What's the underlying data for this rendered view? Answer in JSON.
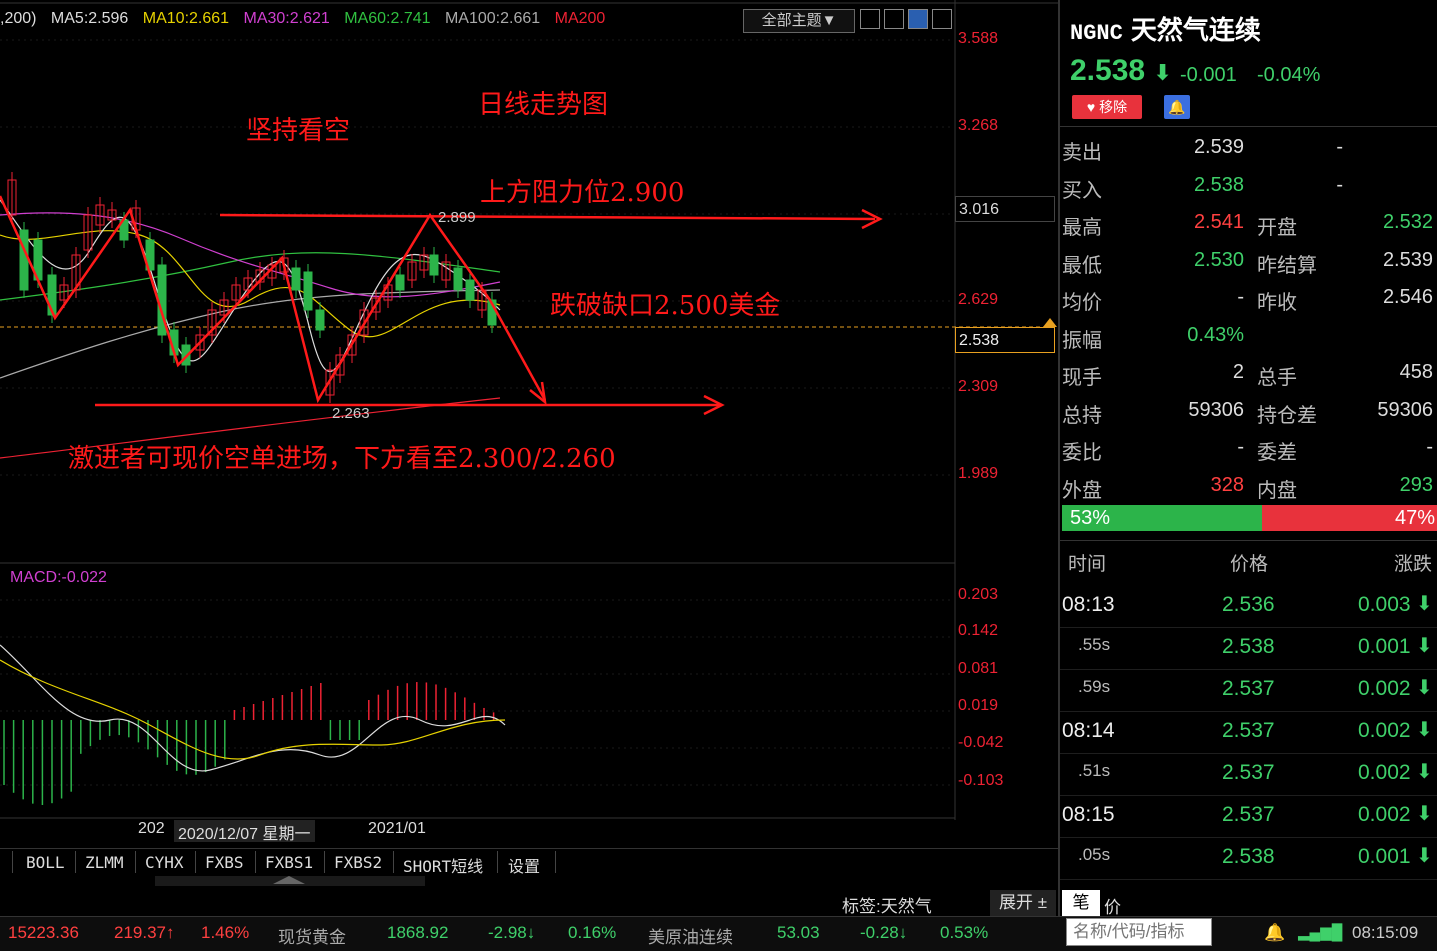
{
  "ma_legend": {
    "prefix": ",200)",
    "ma5": "MA5:2.596",
    "ma10": "MA10:2.661",
    "ma30": "MA30:2.621",
    "ma60": "MA60:2.741",
    "ma100": "MA100:2.661",
    "ma200": "MA200"
  },
  "toolbar": {
    "theme_label": "全部主题▼"
  },
  "price_axis": [
    "3.588",
    "3.268",
    "3.016",
    "2.629",
    "2.538",
    "2.309",
    "1.989"
  ],
  "annotations": {
    "title": "日线走势图",
    "stance": "坚持看空",
    "resistance": "上方阻力位2.900",
    "break_gap": "跌破缺口2.500美金",
    "entry": "激进者可现价空单进场，下方看至2.300/2.260",
    "high_mark": "2.899",
    "low_mark": "2.263"
  },
  "macd": {
    "label": "MACD:-0.022",
    "axis": [
      "0.203",
      "0.142",
      "0.081",
      "0.019",
      "-0.042",
      "-0.103"
    ]
  },
  "date_bar": {
    "left": "202",
    "cursor": "2020/12/07 星期一",
    "right": "2021/01"
  },
  "indicator_tabs": [
    "BOLL",
    "ZLMM",
    "CYHX",
    "FXBS",
    "FXBS1",
    "FXBS2",
    "SHORT短线",
    "设置"
  ],
  "bottom_right": {
    "tag": "标签:天然气",
    "expand": "展开 ±"
  },
  "ticker": [
    {
      "text": "15223.36",
      "color": "#ff4040"
    },
    {
      "text": "219.37↑",
      "color": "#ff4040"
    },
    {
      "text": "1.46%",
      "color": "#ff4040"
    },
    {
      "text": "现货黄金",
      "color": "#aaaaaa"
    },
    {
      "text": "1868.92",
      "color": "#3fd06a"
    },
    {
      "text": "-2.98↓",
      "color": "#3fd06a"
    },
    {
      "text": "0.16%",
      "color": "#3fd06a"
    },
    {
      "text": "美原油连续",
      "color": "#aaaaaa"
    },
    {
      "text": "53.03",
      "color": "#3fd06a"
    },
    {
      "text": "-0.28↓",
      "color": "#3fd06a"
    },
    {
      "text": "0.53%",
      "color": "#3fd06a"
    }
  ],
  "clock": "08:15:09",
  "quote": {
    "code": "NGNC",
    "name": "天然气连续",
    "last": "2.538",
    "change": "-0.001",
    "change_pct": "-0.04%",
    "remove_label": "移除",
    "rows": [
      {
        "l1": "卖出",
        "v1": "2.539",
        "c1": "#dddddd",
        "l2": "",
        "v2": "-",
        "c2": "#dddddd"
      },
      {
        "l1": "买入",
        "v1": "2.538",
        "c1": "#3fd06a",
        "l2": "",
        "v2": "-",
        "c2": "#dddddd"
      },
      {
        "l1": "最高",
        "v1": "2.541",
        "c1": "#ff4040",
        "l2": "开盘",
        "v2": "2.532",
        "c2": "#3fd06a"
      },
      {
        "l1": "最低",
        "v1": "2.530",
        "c1": "#3fd06a",
        "l2": "昨结算",
        "v2": "2.539",
        "c2": "#dddddd"
      },
      {
        "l1": "均价",
        "v1": "-",
        "c1": "#dddddd",
        "l2": "昨收",
        "v2": "2.546",
        "c2": "#dddddd"
      },
      {
        "l1": "振幅",
        "v1": "0.43%",
        "c1": "#3fd06a",
        "l2": "",
        "v2": "",
        "c2": "#dddddd"
      },
      {
        "l1": "现手",
        "v1": "2",
        "c1": "#dddddd",
        "l2": "总手",
        "v2": "458",
        "c2": "#dddddd"
      },
      {
        "l1": "总持",
        "v1": "59306",
        "c1": "#dddddd",
        "l2": "持仓差",
        "v2": "59306",
        "c2": "#dddddd"
      },
      {
        "l1": "委比",
        "v1": "-",
        "c1": "#dddddd",
        "l2": "委差",
        "v2": "-",
        "c2": "#dddddd"
      },
      {
        "l1": "外盘",
        "v1": "328",
        "c1": "#ff4040",
        "l2": "内盘",
        "v2": "293",
        "c2": "#3fd06a"
      }
    ],
    "buy_ratio": "53%",
    "sell_ratio": "47%",
    "buy_fraction": 0.53
  },
  "ticks_header": {
    "time": "时间",
    "price": "价格",
    "change": "涨跌"
  },
  "ticks": [
    {
      "time": "08:13",
      "sec": false,
      "price": "2.536",
      "change": "0.003"
    },
    {
      "time": ".55s",
      "sec": true,
      "price": "2.538",
      "change": "0.001"
    },
    {
      "time": ".59s",
      "sec": true,
      "price": "2.537",
      "change": "0.002"
    },
    {
      "time": "08:14",
      "sec": false,
      "price": "2.537",
      "change": "0.002"
    },
    {
      "time": ".51s",
      "sec": true,
      "price": "2.537",
      "change": "0.002"
    },
    {
      "time": "08:15",
      "sec": false,
      "price": "2.537",
      "change": "0.002"
    },
    {
      "time": ".05s",
      "sec": true,
      "price": "2.538",
      "change": "0.001"
    }
  ],
  "panel_tabs": {
    "bi": "笔",
    "jia": "价"
  },
  "search_placeholder": "名称/代码/指标"
}
